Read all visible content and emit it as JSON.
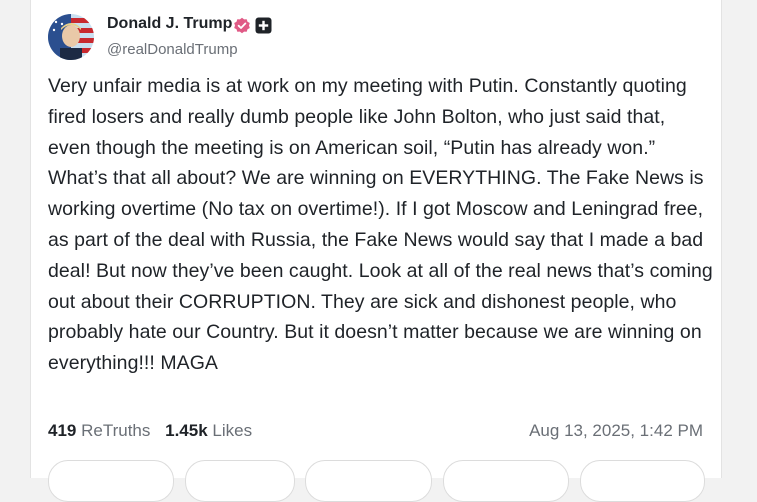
{
  "post": {
    "author": {
      "display_name": "Donald J. Trump",
      "handle": "@realDonaldTrump",
      "verified_color": "#e05a86"
    },
    "text": "Very unfair media is at work on my meeting with Putin. Constantly quoting fired losers and really dumb people like John Bolton, who just said that, even though the meeting is on American soil, “Putin has already won.” What’s that all about? We are winning on EVERYTHING. The Fake News is working overtime (No tax on overtime!). If I got Moscow and Leningrad free, as part of the deal with Russia, the Fake News would say that I made a bad deal! But now they’ve been caught. Look at all of the real news that’s coming out about their CORRUPTION. They are sick and dishonest people, who probably hate our Country. But it doesn’t matter because we are winning on everything!!! MAGA",
    "stats": {
      "retruths_count": "419",
      "retruths_label": "ReTruths",
      "likes_count": "1.45k",
      "likes_label": "Likes"
    },
    "timestamp": "Aug 13, 2025, 1:42 PM"
  },
  "icons": {
    "verified": "verified-badge-icon",
    "plus": "plus-square-icon"
  }
}
